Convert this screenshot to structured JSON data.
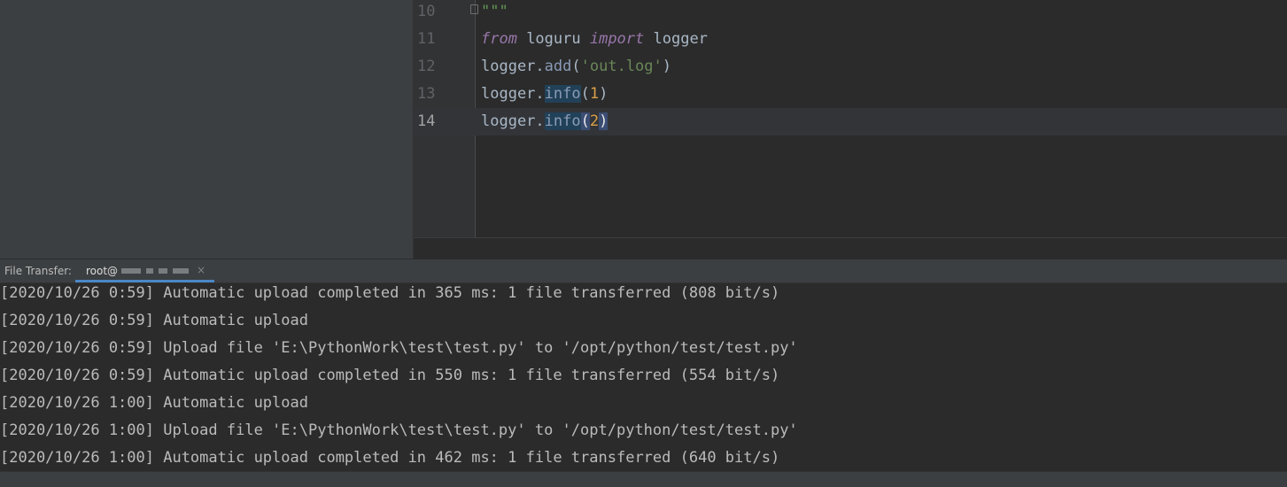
{
  "editor": {
    "lines": [
      {
        "number": "10",
        "tokens": [
          {
            "text": "\"\"\"",
            "type": "doc"
          }
        ]
      },
      {
        "number": "11",
        "tokens": [
          {
            "text": "from",
            "type": "kw2"
          },
          {
            "text": " loguru ",
            "type": "plain"
          },
          {
            "text": "import",
            "type": "kw2"
          },
          {
            "text": " logger",
            "type": "plain"
          }
        ]
      },
      {
        "number": "12",
        "tokens": [
          {
            "text": "logger.",
            "type": "plain"
          },
          {
            "text": "add",
            "type": "fn"
          },
          {
            "text": "(",
            "type": "plain"
          },
          {
            "text": "'out.log'",
            "type": "str"
          },
          {
            "text": ")",
            "type": "plain"
          }
        ]
      },
      {
        "number": "13",
        "tokens": [
          {
            "text": "logger.",
            "type": "plain"
          },
          {
            "text": "info",
            "type": "fn-hl"
          },
          {
            "text": "(",
            "type": "plain"
          },
          {
            "text": "1",
            "type": "num"
          },
          {
            "text": ")",
            "type": "plain"
          }
        ]
      },
      {
        "number": "14",
        "tokens": [
          {
            "text": "logger.",
            "type": "plain"
          },
          {
            "text": "info",
            "type": "fn-hl"
          },
          {
            "text": "(",
            "type": "brace"
          },
          {
            "text": "2",
            "type": "num"
          },
          {
            "text": ")",
            "type": "brace"
          }
        ]
      }
    ]
  },
  "panel": {
    "label": "File Transfer:",
    "tab_label": "root@",
    "close_glyph": "×"
  },
  "console": {
    "lines": [
      "[2020/10/26 0:59] Automatic upload completed in 365 ms: 1 file transferred (808 bit/s)",
      "[2020/10/26 0:59] Automatic upload",
      "[2020/10/26 0:59] Upload file 'E:\\PythonWork\\test\\test.py' to '/opt/python/test/test.py'",
      "[2020/10/26 0:59] Automatic upload completed in 550 ms: 1 file transferred (554 bit/s)",
      "[2020/10/26 1:00] Automatic upload",
      "[2020/10/26 1:00] Upload file 'E:\\PythonWork\\test\\test.py' to '/opt/python/test/test.py'",
      "[2020/10/26 1:00] Automatic upload completed in 462 ms: 1 file transferred (640 bit/s)"
    ]
  }
}
